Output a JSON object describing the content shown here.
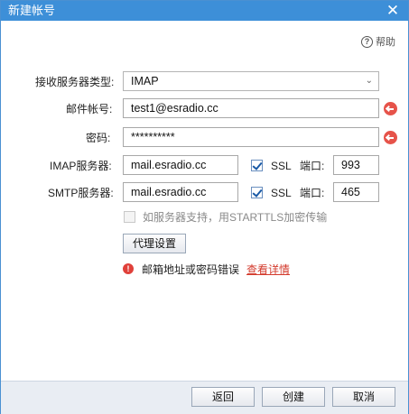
{
  "window": {
    "title": "新建帐号",
    "close_glyph": "✕"
  },
  "help": {
    "label": "帮助",
    "icon": "question-circle-icon"
  },
  "form": {
    "server_type": {
      "label": "接收服务器类型:",
      "value": "IMAP"
    },
    "account": {
      "label": "邮件帐号:",
      "value": "test1@esradio.cc"
    },
    "password": {
      "label": "密码:",
      "value": "**********"
    },
    "imap": {
      "label": "IMAP服务器:",
      "host": "mail.esradio.cc",
      "ssl_label": "SSL",
      "ssl_checked": true,
      "port_label": "端口:",
      "port": "993"
    },
    "smtp": {
      "label": "SMTP服务器:",
      "host": "mail.esradio.cc",
      "ssl_label": "SSL",
      "ssl_checked": true,
      "port_label": "端口:",
      "port": "465"
    },
    "starttls": {
      "label": "如服务器支持，用STARTTLS加密传输",
      "checked": false,
      "enabled": false
    },
    "proxy_button": "代理设置"
  },
  "status": {
    "message": "邮箱地址或密码错误",
    "link": "查看详情",
    "color": "#d33a2c"
  },
  "footer": {
    "back": "返回",
    "create": "创建",
    "cancel": "取消"
  },
  "colors": {
    "titlebar": "#3d8fd8",
    "error": "#e6534a"
  }
}
